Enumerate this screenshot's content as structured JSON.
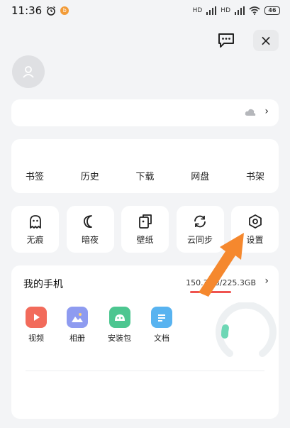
{
  "status": {
    "time": "11:36",
    "battery": "46",
    "signal1": "HD",
    "signal2": "HD"
  },
  "header": {
    "close_label": "×"
  },
  "account": {
    "chevron": "›"
  },
  "shortcuts": [
    {
      "label": "书签"
    },
    {
      "label": "历史"
    },
    {
      "label": "下载"
    },
    {
      "label": "网盘"
    },
    {
      "label": "书架"
    }
  ],
  "tools": [
    {
      "label": "无痕",
      "icon": "ghost-icon"
    },
    {
      "label": "暗夜",
      "icon": "moon-icon"
    },
    {
      "label": "壁纸",
      "icon": "wallpaper-icon"
    },
    {
      "label": "云同步",
      "icon": "sync-icon"
    },
    {
      "label": "设置",
      "icon": "settings-icon"
    }
  ],
  "phone": {
    "title": "我的手机",
    "storage": "150.3GB/225.3GB",
    "storage_used_fraction": 0.667,
    "chevron": "›",
    "apps": [
      {
        "label": "视频",
        "icon": "video-icon",
        "color": "#f26b5b"
      },
      {
        "label": "相册",
        "icon": "gallery-icon",
        "color": "#8e9bf0"
      },
      {
        "label": "安装包",
        "icon": "android-icon",
        "color": "#4cc690"
      },
      {
        "label": "文档",
        "icon": "document-icon",
        "color": "#58b3f0"
      }
    ]
  },
  "colors": {
    "accent_arrow": "#f5882e",
    "storage_bar": "#ef5350"
  }
}
